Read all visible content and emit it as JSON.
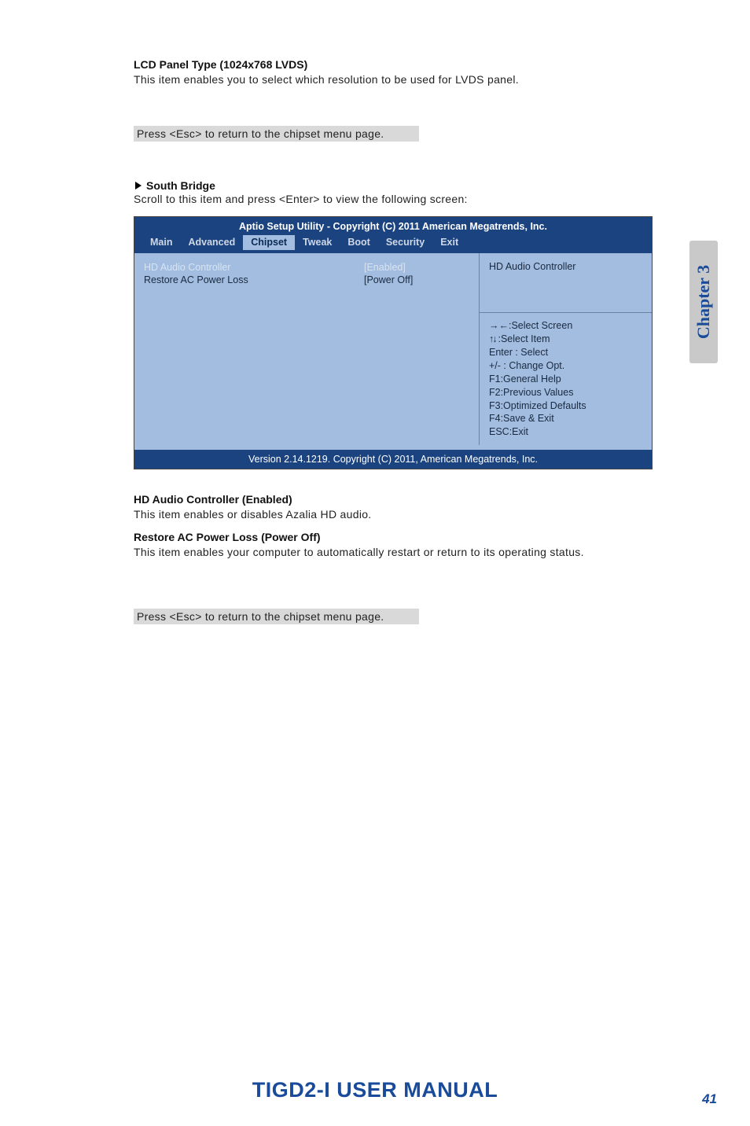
{
  "head1": {
    "title": "LCD Panel Type (1024x768   LVDS)",
    "desc": "This item enables you to select which resolution to be used for LVDS panel."
  },
  "esc_note1": "Press <Esc> to return to the chipset menu page.",
  "south": {
    "title": "South Bridge",
    "desc": "Scroll to this item and press <Enter> to view the following screen:"
  },
  "bios": {
    "title": "Aptio Setup Utility - Copyright (C) 2011 American Megatrends, Inc.",
    "tabs": {
      "main": "Main",
      "advanced": "Advanced",
      "chipset": "Chipset",
      "tweak": "Tweak",
      "boot": "Boot",
      "security": "Security",
      "exit": "Exit"
    },
    "rows": {
      "r0": {
        "label": "HD Audio Controller",
        "value": "[Enabled]"
      },
      "r1": {
        "label": "Restore AC Power Loss",
        "value": "[Power Off]"
      }
    },
    "right_top": "HD Audio Controller",
    "help": {
      "l0": ":Select Screen",
      "l1": ":Select Item",
      "l2": "Enter : Select",
      "l3": "+/-  : Change Opt.",
      "l4": "F1:General Help",
      "l5": "F2:Previous Values",
      "l6": "F3:Optimized Defaults",
      "l7": "F4:Save & Exit",
      "l8": "ESC:Exit"
    },
    "footer": "Version 2.14.1219. Copyright (C) 2011, American Megatrends, Inc."
  },
  "sec2": {
    "title": "HD Audio Controller (Enabled)",
    "desc": "This item enables or disables Azalia HD audio."
  },
  "sec3": {
    "title": "Restore AC Power Loss (Power Off)",
    "desc": "This item enables your computer to automatically restart or return to its operating status."
  },
  "esc_note2": "Press <Esc> to return to the chipset menu page.",
  "side_tab": "Chapter 3",
  "doc_footer": "TIGD2-I USER MANUAL",
  "page_no": "41"
}
